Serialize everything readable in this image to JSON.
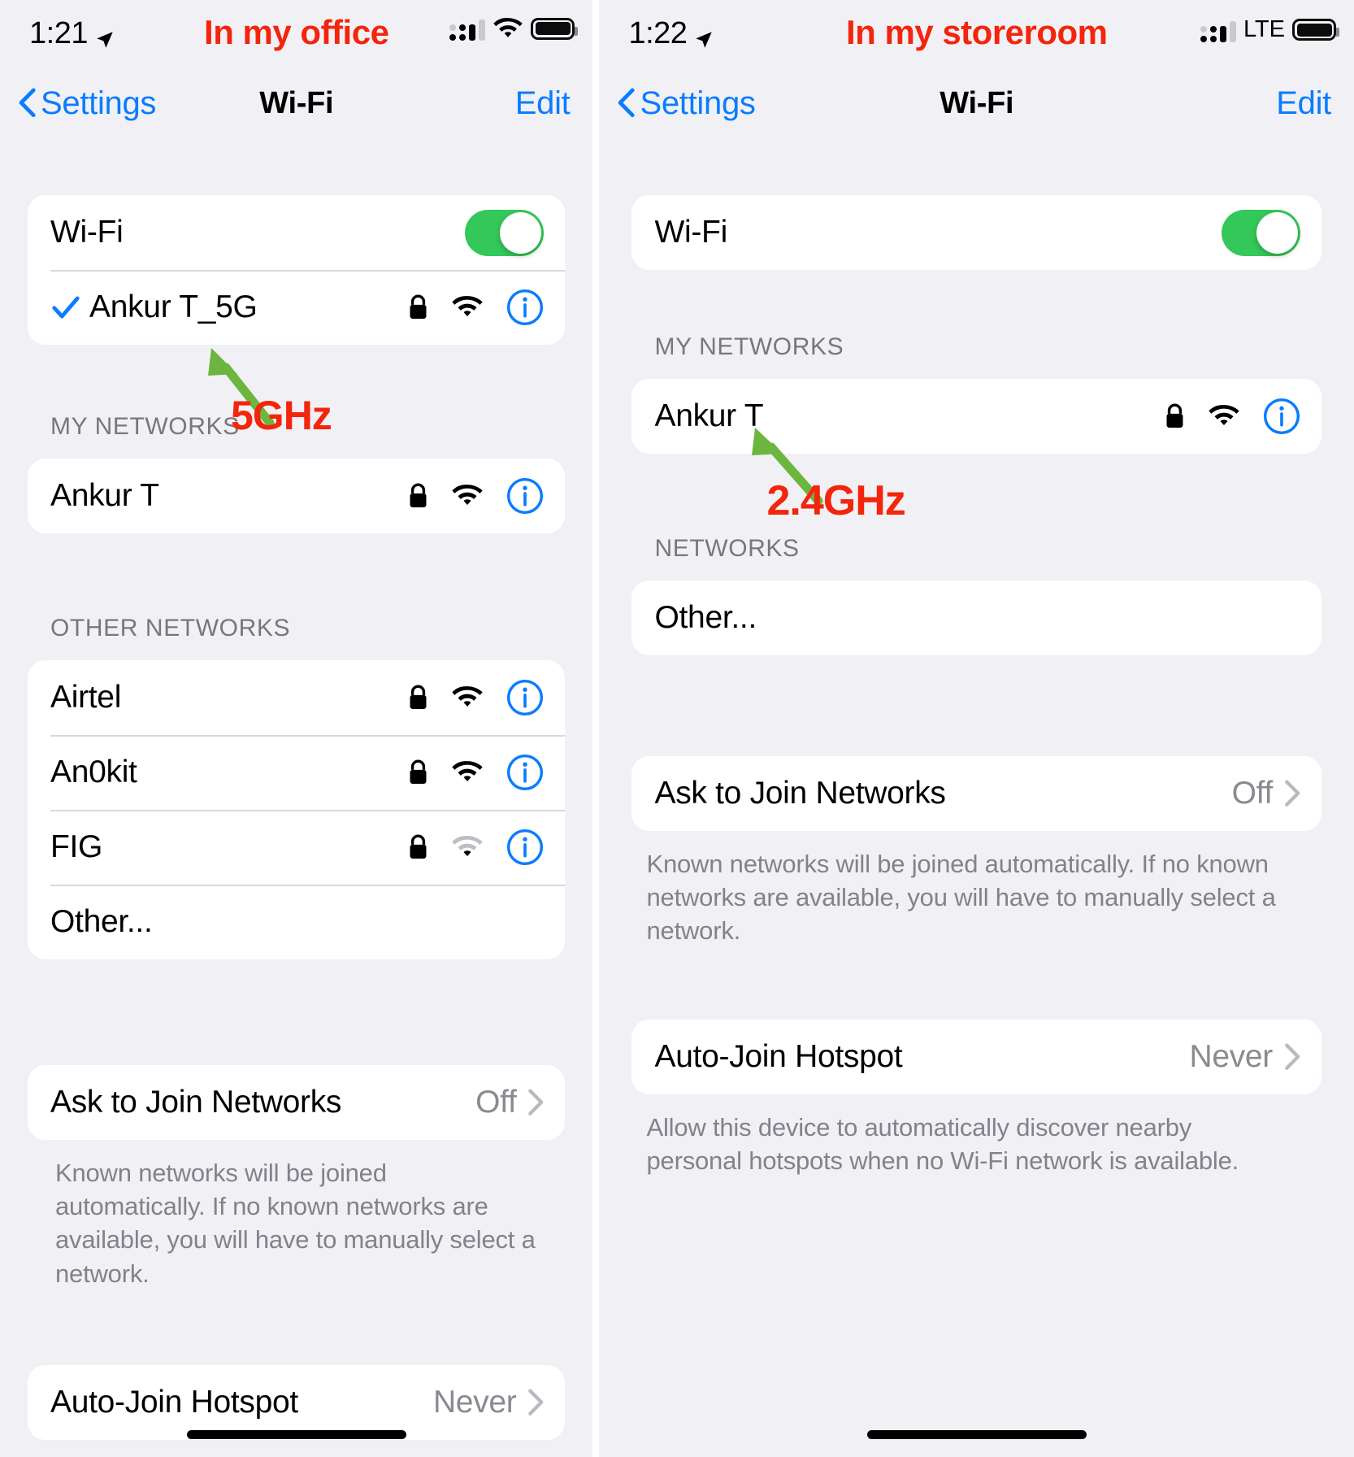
{
  "left": {
    "status": {
      "time": "1:21",
      "location_icon": "location-arrow-icon",
      "caption": "In my office",
      "signal_icon": "cellular-signal-dots-icon",
      "network_icon": "wifi-icon",
      "battery_icon": "battery-full-icon"
    },
    "nav": {
      "back_label": "Settings",
      "title": "Wi-Fi",
      "edit_label": "Edit"
    },
    "wifi_toggle": {
      "label": "Wi-Fi",
      "state": "on"
    },
    "connected": {
      "name": "Ankur T_5G",
      "checked": true,
      "secured": true,
      "signal": "strong"
    },
    "my_networks": {
      "header": "MY NETWORKS",
      "items": [
        {
          "name": "Ankur T",
          "secured": true,
          "signal": "strong"
        }
      ]
    },
    "other_networks": {
      "header": "OTHER NETWORKS",
      "items": [
        {
          "name": "Airtel",
          "secured": true,
          "signal": "strong"
        },
        {
          "name": "An0kit",
          "secured": true,
          "signal": "strong"
        },
        {
          "name": "FIG",
          "secured": true,
          "signal": "weak"
        }
      ],
      "other_label": "Other..."
    },
    "ask_to_join": {
      "label": "Ask to Join Networks",
      "value": "Off",
      "footnote": "Known networks will be joined automatically. If no known networks are available, you will have to manually select a network."
    },
    "auto_join_hotspot": {
      "label": "Auto-Join Hotspot",
      "value": "Never"
    },
    "annotations": {
      "band_label": "5GHz",
      "underline_color": "#6cb63f",
      "arrow_color": "#6cb63f",
      "text_color": "#f4240d"
    }
  },
  "right": {
    "status": {
      "time": "1:22",
      "location_icon": "location-arrow-icon",
      "caption": "In my storeroom",
      "signal_icon": "cellular-signal-dots-icon",
      "network_label": "LTE",
      "battery_icon": "battery-full-icon"
    },
    "nav": {
      "back_label": "Settings",
      "title": "Wi-Fi",
      "edit_label": "Edit"
    },
    "wifi_toggle": {
      "label": "Wi-Fi",
      "state": "on"
    },
    "my_networks": {
      "header": "MY NETWORKS",
      "items": [
        {
          "name": "Ankur T",
          "secured": true,
          "signal": "strong"
        }
      ]
    },
    "networks": {
      "header": "NETWORKS",
      "other_label": "Other..."
    },
    "ask_to_join": {
      "label": "Ask to Join Networks",
      "value": "Off",
      "footnote": "Known networks will be joined automatically. If no known networks are available, you will have to manually select a network."
    },
    "auto_join_hotspot": {
      "label": "Auto-Join Hotspot",
      "value": "Never",
      "footnote": "Allow this device to automatically discover nearby personal hotspots when no Wi-Fi network is available."
    },
    "annotations": {
      "band_label": "2.4GHz",
      "arrow_color": "#6cb63f",
      "text_color": "#f4240d"
    }
  }
}
